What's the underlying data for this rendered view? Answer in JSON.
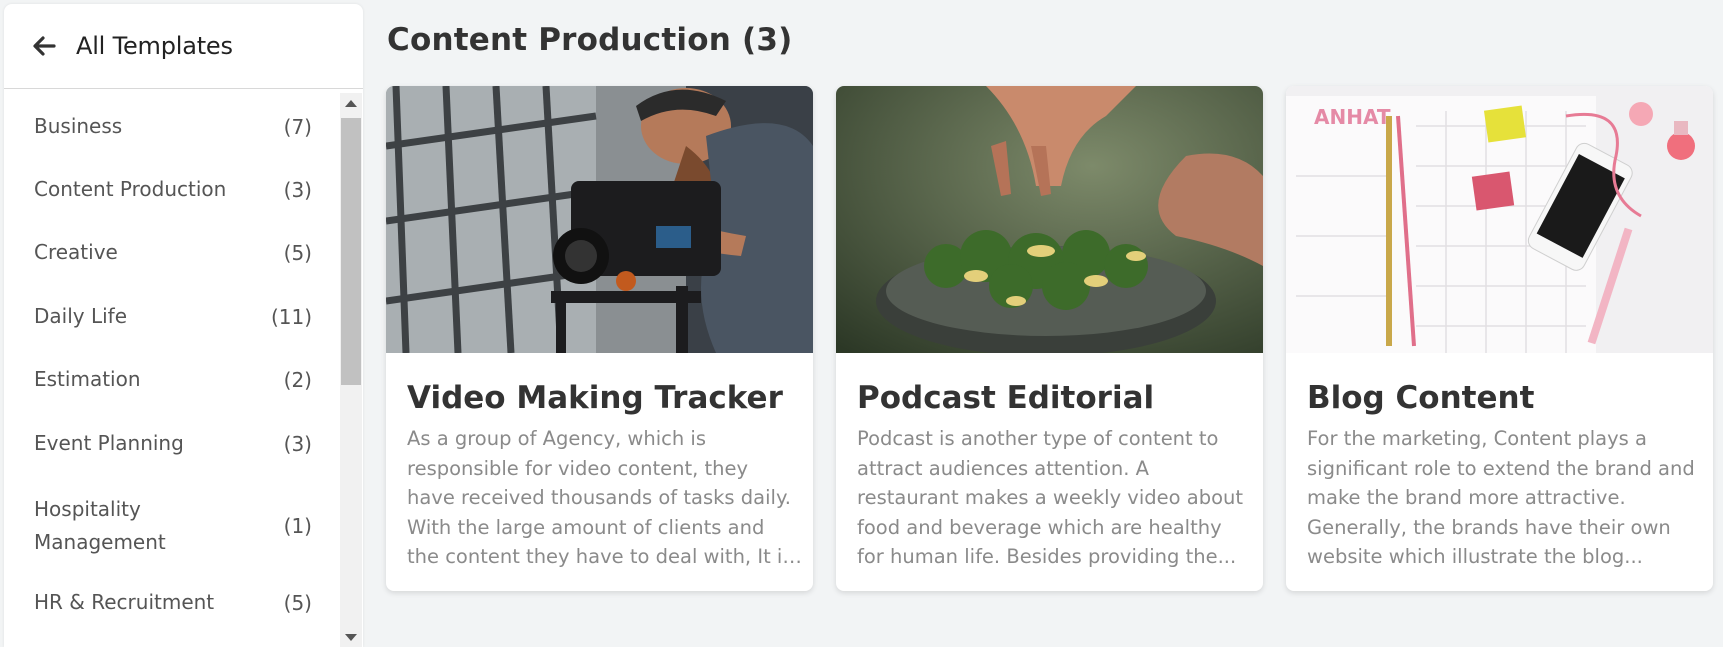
{
  "sidebar": {
    "back_label": "All Templates",
    "categories": [
      {
        "name": "Business",
        "count": "(7)"
      },
      {
        "name": "Content Production",
        "count": "(3)"
      },
      {
        "name": "Creative",
        "count": "(5)"
      },
      {
        "name": "Daily Life",
        "count": "(11)"
      },
      {
        "name": "Estimation",
        "count": "(2)"
      },
      {
        "name": "Event Planning",
        "count": "(3)"
      },
      {
        "name": "Hospitality Management",
        "count": "(1)"
      },
      {
        "name": "HR & Recruitment",
        "count": "(5)"
      }
    ]
  },
  "main": {
    "section_title": "Content Production (3)",
    "cards": [
      {
        "title": "Video Making Tracker",
        "description": "As a group of Agency, which is responsible for video content, they have received thousands of tasks daily. With the large amount of clients and the content they have to deal with, It is ve...",
        "image_icon": "videographer-camera-photo"
      },
      {
        "title": "Podcast Editorial",
        "description": "Podcast is another type of content to attract audiences attention. A restaurant makes a weekly video about food and beverage which are healthy for human life. Besides providing the...",
        "image_icon": "food-salad-photo"
      },
      {
        "title": "Blog Content",
        "description": "For the marketing, Content plays a significant role to extend the brand and make the brand more attractive. Generally, the brands have their own website which illustrate the blog...",
        "image_icon": "planner-phone-photo"
      }
    ]
  },
  "colors": {
    "background": "#f2f4f5",
    "card_bg": "#ffffff",
    "title_text": "#333333",
    "muted_text": "#8a8a8a",
    "scroll_thumb": "#c1c1c1"
  }
}
